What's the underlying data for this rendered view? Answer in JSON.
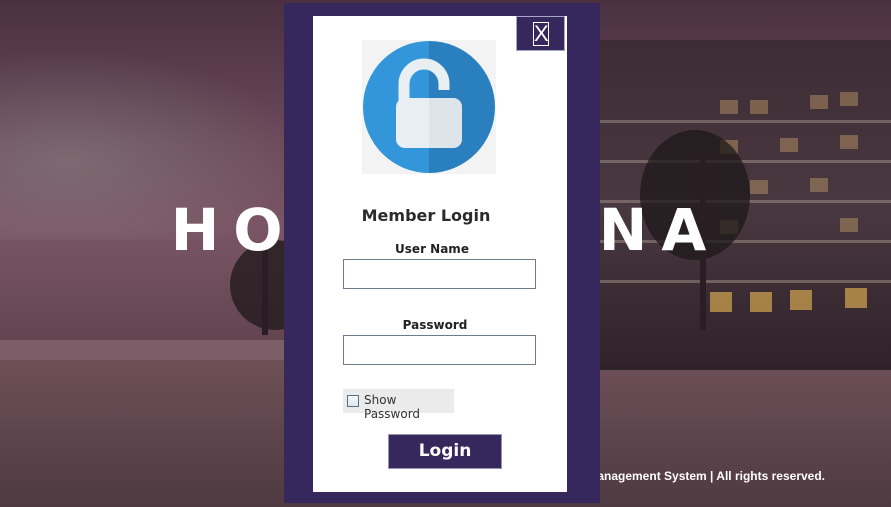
{
  "background": {
    "brand_title": "HOTEL LANA",
    "footer_text": "tel Management System | All rights reserved."
  },
  "modal": {
    "close_label": "X",
    "heading": "Member Login",
    "username_label": "User Name",
    "username_value": "",
    "password_label": "Password",
    "password_value": "",
    "show_password_label": "Show Password",
    "show_password_checked": false,
    "login_label": "Login",
    "lock_icon": "unlocked-padlock-icon"
  },
  "colors": {
    "modal_frame": "#36285c",
    "lock_circle_light": "#3396db",
    "lock_circle_dark": "#2a80bf",
    "lock_body": "#e9eef3"
  }
}
